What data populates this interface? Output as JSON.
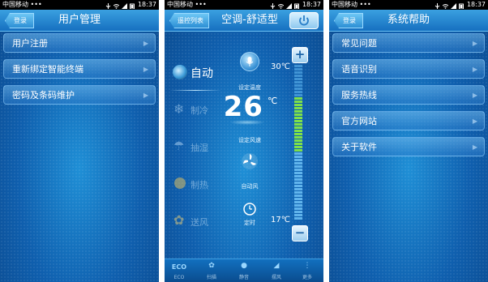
{
  "status": {
    "carrier": "中国移动 •••",
    "time": "18:37"
  },
  "screen1": {
    "back_label": "登录",
    "title": "用户管理",
    "menu": [
      "用户注册",
      "重新绑定智能终端",
      "密码及条码维护"
    ]
  },
  "screen2": {
    "list_button": "遥控列表",
    "title": "空调-舒适型",
    "modes": [
      {
        "label": "自动",
        "icon": "auto-mode-icon"
      },
      {
        "label": "制冷",
        "icon": "snowflake-icon"
      },
      {
        "label": "抽湿",
        "icon": "dehumidify-icon"
      },
      {
        "label": "制热",
        "icon": "sun-icon"
      },
      {
        "label": "送风",
        "icon": "fan-blow-icon"
      }
    ],
    "set_temp_label": "设定温度",
    "temperature": "26",
    "temp_unit": "℃",
    "max_temp": "30℃",
    "min_temp": "17℃",
    "set_fan_label": "设定风速",
    "fan_mode": "自动风",
    "timer_label": "定时",
    "tabs": [
      {
        "label": "ECO",
        "icon": "eco-icon"
      },
      {
        "label": "扫描",
        "icon": "fan-icon"
      },
      {
        "label": "静音",
        "icon": "bulb-icon"
      },
      {
        "label": "摆风",
        "icon": "swing-icon"
      },
      {
        "label": "更多",
        "icon": "more-icon"
      }
    ],
    "colors": {
      "accent": "#7ee04a",
      "background": "#0f5fae"
    }
  },
  "screen3": {
    "back_label": "登录",
    "title": "系统帮助",
    "menu": [
      "常见问题",
      "语音识别",
      "服务热线",
      "官方网站",
      "关于软件"
    ]
  }
}
